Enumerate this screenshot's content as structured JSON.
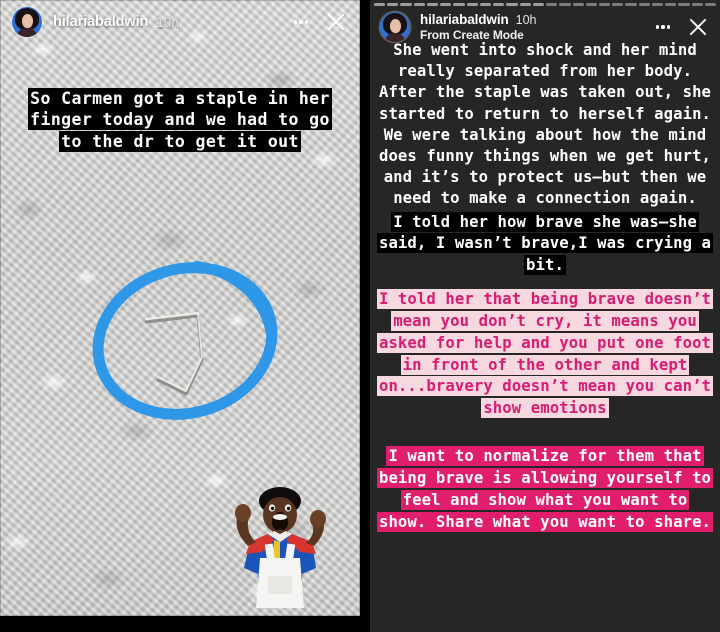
{
  "left_panel": {
    "header": {
      "username": "hilariabaldwin",
      "timestamp": "10h",
      "more_icon": "more-options-icon",
      "close_icon": "close-icon",
      "avatar": "user-avatar"
    },
    "caption": "So Carmen got a staple in her finger today and we had to go to the dr to get it out",
    "annotations": {
      "circle_color": "#2f97e8",
      "circle_label": "blue-hand-drawn-circle",
      "subject": "bent-staple-on-carpet",
      "sticker": "shocked-person-sticker"
    },
    "background_description": "gray-carpet-texture"
  },
  "right_panel": {
    "header": {
      "username": "hilariabaldwin",
      "timestamp": "10h",
      "subtitle": "From Create Mode",
      "more_icon": "more-options-icon",
      "close_icon": "close-icon",
      "avatar": "user-avatar"
    },
    "progress_segments": 26,
    "progress_active_index": 13,
    "paragraphs": [
      {
        "style": "plain",
        "text": "She went into shock and her mind really separated from her body. After the staple was taken out, she started to return to herself again. We were talking about how the mind does funny things when we get hurt, and it’s to protect us—but then we need to make a connection again."
      },
      {
        "style": "black-highlight",
        "text": "I told her how brave she was—she said, I wasn’t brave,I was crying a bit."
      },
      {
        "style": "light-pink-highlight",
        "text": "I told her that being brave doesn’t mean you don’t cry, it means you asked for help and you put one foot in front of the other and kept on...bravery doesn’t mean you can’t show emotions"
      },
      {
        "style": "hot-pink-highlight",
        "text": "I want to normalize for them that being brave is allowing yourself to feel and show what you want to show. Share what you want to share."
      }
    ],
    "colors": {
      "background": "#262626",
      "black_highlight_bg": "#000000",
      "black_highlight_text": "#ffffff",
      "light_pink_bg": "#f6d8de",
      "light_pink_text": "#d81b73",
      "hot_pink_bg": "#e01e6c",
      "hot_pink_text": "#ffffff"
    }
  }
}
